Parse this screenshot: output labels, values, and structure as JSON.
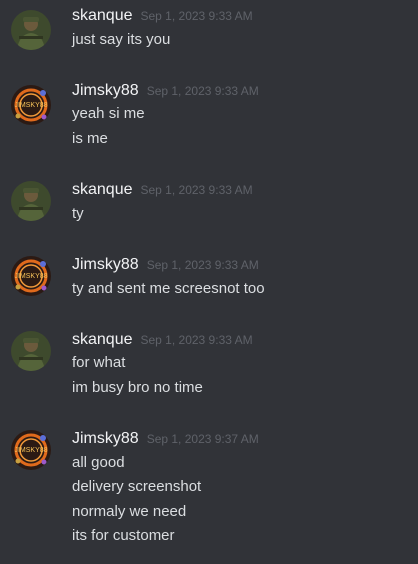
{
  "messages": [
    {
      "author": "skanque",
      "avatar": "soldier-avatar",
      "time": "Sep 1, 2023 9:33 AM",
      "lines": [
        "just say its you"
      ]
    },
    {
      "author": "Jimsky88",
      "avatar": "ring-logo-avatar",
      "time": "Sep 1, 2023 9:33 AM",
      "lines": [
        "yeah si me",
        "is me"
      ]
    },
    {
      "author": "skanque",
      "avatar": "soldier-avatar",
      "time": "Sep 1, 2023 9:33 AM",
      "lines": [
        "ty"
      ]
    },
    {
      "author": "Jimsky88",
      "avatar": "ring-logo-avatar",
      "time": "Sep 1, 2023 9:33 AM",
      "lines": [
        "ty and sent me screesnot too"
      ]
    },
    {
      "author": "skanque",
      "avatar": "soldier-avatar",
      "time": "Sep 1, 2023 9:33 AM",
      "lines": [
        "for what",
        "im busy bro no time"
      ]
    },
    {
      "author": "Jimsky88",
      "avatar": "ring-logo-avatar",
      "time": "Sep 1, 2023 9:37 AM",
      "lines": [
        "all good",
        "delivery screenshot",
        "normaly we need",
        "its for customer"
      ]
    }
  ],
  "avatar_labels": {
    "ring_logo_text": "JIMSKY88"
  },
  "colors": {
    "background": "#313338",
    "username": "#f2f3f5",
    "text": "#dbdee1",
    "timestamp": "#5f6269"
  }
}
